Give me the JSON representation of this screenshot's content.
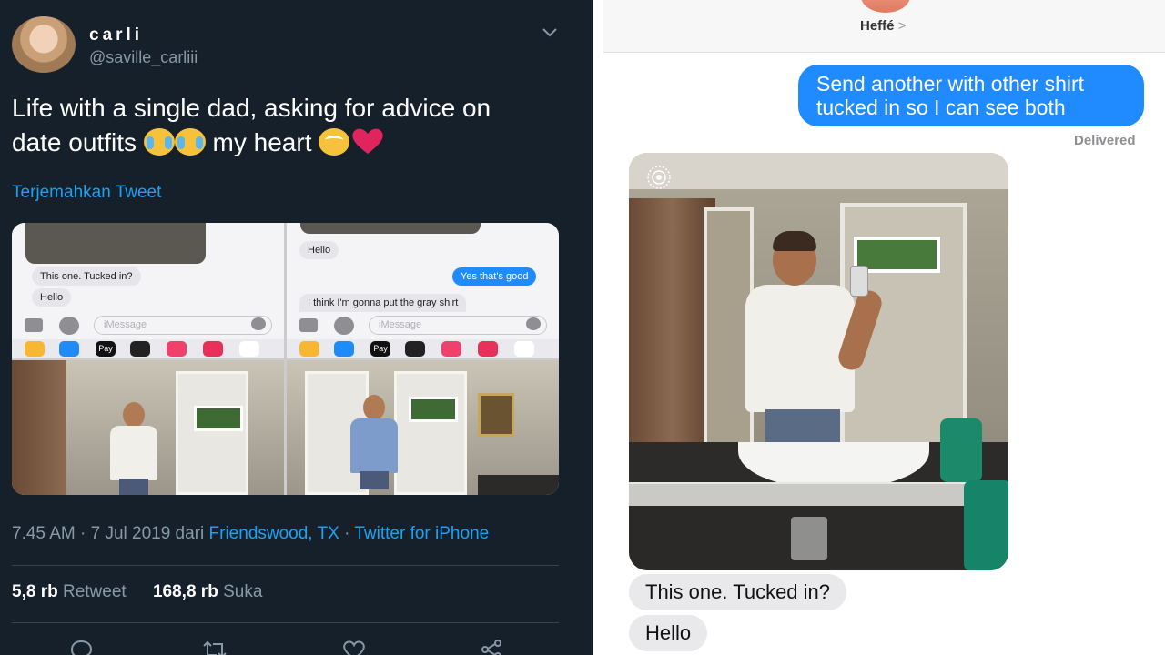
{
  "tweet": {
    "display_name": "carli",
    "handle": "@saville_carliii",
    "text_line1": "Life with a single dad, asking for advice on",
    "text_line2_a": "date outfits",
    "text_line2_b": "my heart",
    "translate_label": "Terjemahkan Tweet",
    "time_date": "7.45 AM · 7 Jul 2019 dari",
    "location": "Friendswood, TX",
    "separator": "·",
    "source": "Twitter for iPhone",
    "retweet_count": "5,8 rb",
    "retweet_label": "Retweet",
    "like_count": "168,8 rb",
    "like_label": "Suka",
    "media": {
      "thumb1": {
        "bubble1": "This one. Tucked in?",
        "bubble2": "Hello",
        "placeholder": "iMessage"
      },
      "thumb2": {
        "bubble1": "Hello",
        "bubble2": "Yes that's good",
        "bubble3": "I think I'm gonna put the gray shirt",
        "placeholder": "iMessage"
      },
      "apple_pay_label": "Pay"
    }
  },
  "chat": {
    "contact_name": "Heffé",
    "contact_arrow": ">",
    "sent_message_line1": "Send another with other shirt",
    "sent_message_line2": "tucked in so I can see both",
    "delivered_label": "Delivered",
    "received_1": "This one. Tucked in?",
    "received_2": "Hello"
  },
  "colors": {
    "tweet_bg": "#15202b",
    "link": "#1da1f2",
    "imessage_blue": "#1f8bff",
    "received_bubble": "#e9e9eb"
  },
  "icons": [
    "chevron-down-icon",
    "reply-icon",
    "retweet-icon",
    "like-icon",
    "share-icon",
    "live-photo-icon",
    "camera-icon",
    "app-store-icon",
    "mic-icon"
  ]
}
